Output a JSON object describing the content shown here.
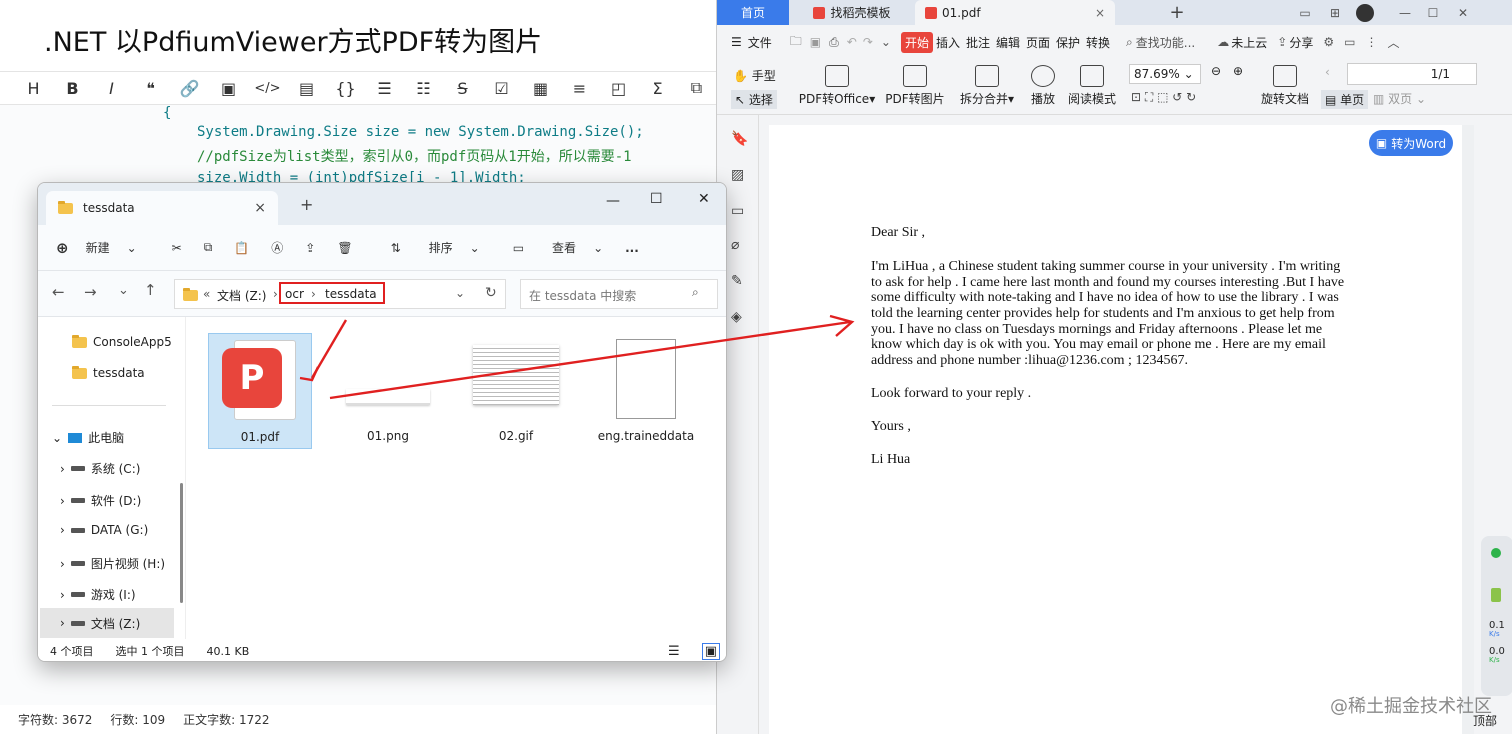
{
  "editor": {
    "title": ".NET 以PdfiumViewer方式PDF转为图片",
    "toolbar": [
      "H",
      "B",
      "I",
      "❝",
      "🔗",
      "▣",
      "</>",
      "▤",
      "{}",
      "☰",
      "☷",
      "S",
      "☑",
      "▦",
      "≡",
      "◰",
      "Σ",
      "⧉"
    ],
    "code": [
      "{",
      "System.Drawing.Size size = new System.Drawing.Size();",
      "//pdfSize为list类型，索引从0，而pdf页码从1开始，所以需要-1",
      "size.Width = (int)pdfSize[i - 1].Width;"
    ],
    "status": {
      "chars": "字符数: 3672",
      "lines": "行数: 109",
      "body_chars": "正文字数: 1722"
    }
  },
  "explorer": {
    "tab_title": "tessdata",
    "commands": {
      "new": "新建",
      "sort": "排序",
      "view": "查看",
      "more": "..."
    },
    "breadcrumb": {
      "root": "文档 (Z:)",
      "part1": "ocr",
      "part2": "tessdata"
    },
    "search_placeholder": "在 tessdata 中搜索",
    "nav": [
      {
        "label": "ConsoleApp5"
      },
      {
        "label": "tessdata"
      },
      {
        "label": "此电脑"
      },
      {
        "label": "系统 (C:)"
      },
      {
        "label": "软件 (D:)"
      },
      {
        "label": "DATA (G:)"
      },
      {
        "label": "图片视频 (H:)"
      },
      {
        "label": "游戏 (I:)"
      },
      {
        "label": "文档 (Z:)"
      }
    ],
    "files": [
      {
        "name": "01.pdf"
      },
      {
        "name": "01.png"
      },
      {
        "name": "02.gif"
      },
      {
        "name": "eng.traineddata"
      }
    ],
    "status": {
      "count": "4 个项目",
      "selected": "选中 1 个项目",
      "size": "40.1 KB"
    }
  },
  "wps": {
    "tabs": {
      "home": "首页",
      "template": "找稻壳模板",
      "doc": "01.pdf"
    },
    "menu": {
      "file": "文件",
      "start": "开始",
      "insert": "插入",
      "annotate": "批注",
      "edit": "编辑",
      "page": "页面",
      "protect": "保护",
      "convert": "转换",
      "search": "查找功能...",
      "cloud": "未上云",
      "share": "分享"
    },
    "ribbon": {
      "hand": "手型",
      "select": "选择",
      "pdf_office": "PDF转Office",
      "pdf_image": "PDF转图片",
      "split": "拆分合并",
      "play": "播放",
      "read": "阅读模式",
      "zoom": "87.69%",
      "rotate": "旋转文档",
      "page": "1/1",
      "single": "单页",
      "double": "双页"
    },
    "to_word": "转为Word",
    "letter": [
      "Dear Sir ,",
      "I'm LiHua , a Chinese student taking summer course in your university . I'm writing",
      "to ask for help . I came here last month and found my courses interesting .But I have",
      "some difficulty with note-taking and I have no idea of how to use the library . I was",
      "told the learning center provides help for students and I'm anxious to get help from",
      "you. I have no class on Tuesdays mornings and Friday afternoons . Please let me",
      "know which day is ok with you. You may email or phone me . Here are my email",
      "address and phone number :lihua@1236.com ; 1234567.",
      "Look forward to your reply .",
      "Yours ,",
      "Li Hua"
    ],
    "side_stats": {
      "up": "0.1",
      "down": "0.0",
      "unit": "K/s"
    },
    "footer": "顶部"
  },
  "watermark": "@稀土掘金技术社区",
  "colors": {
    "wps_accent": "#3a7bea",
    "pdf_red": "#e8453c",
    "arrow": "#e02020"
  }
}
